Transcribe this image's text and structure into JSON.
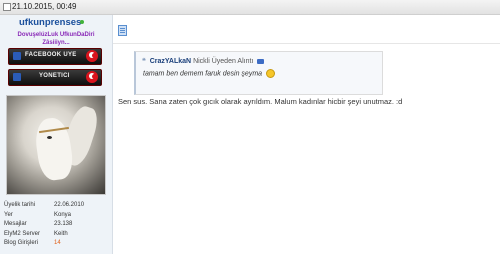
{
  "post": {
    "date": "21.10.2015, 00:49",
    "message": "Sen sus. Sana zaten çok gıcık olarak ayrıldım. Malum kadınlar hicbir şeyi unutmaz. :d"
  },
  "user": {
    "name": "ufkunprenses",
    "motto_line1": "DovuşelúzLuk UfkunDaDiri",
    "motto_line2": "Zâsiiiyn...",
    "banner_facebook": "FACEBOOK UYE",
    "banner_yonetici": "YONETICI",
    "profile": [
      {
        "key": "Üyelik tarihi",
        "value": "22.06.2010"
      },
      {
        "key": "Yer",
        "value": "Konya"
      },
      {
        "key": "Mesajlar",
        "value": "23.138"
      },
      {
        "key": "ElyM2 Server",
        "value": "Keith"
      },
      {
        "key": "Blog Girişleri",
        "value": "14"
      }
    ],
    "status_color": "#41b33a"
  },
  "quote": {
    "mark": "❝",
    "author": "CrazYALkaN",
    "suffix": "Nickli Üyeden Alıntı",
    "text": "tamam ben demem faruk desin şeyma"
  }
}
